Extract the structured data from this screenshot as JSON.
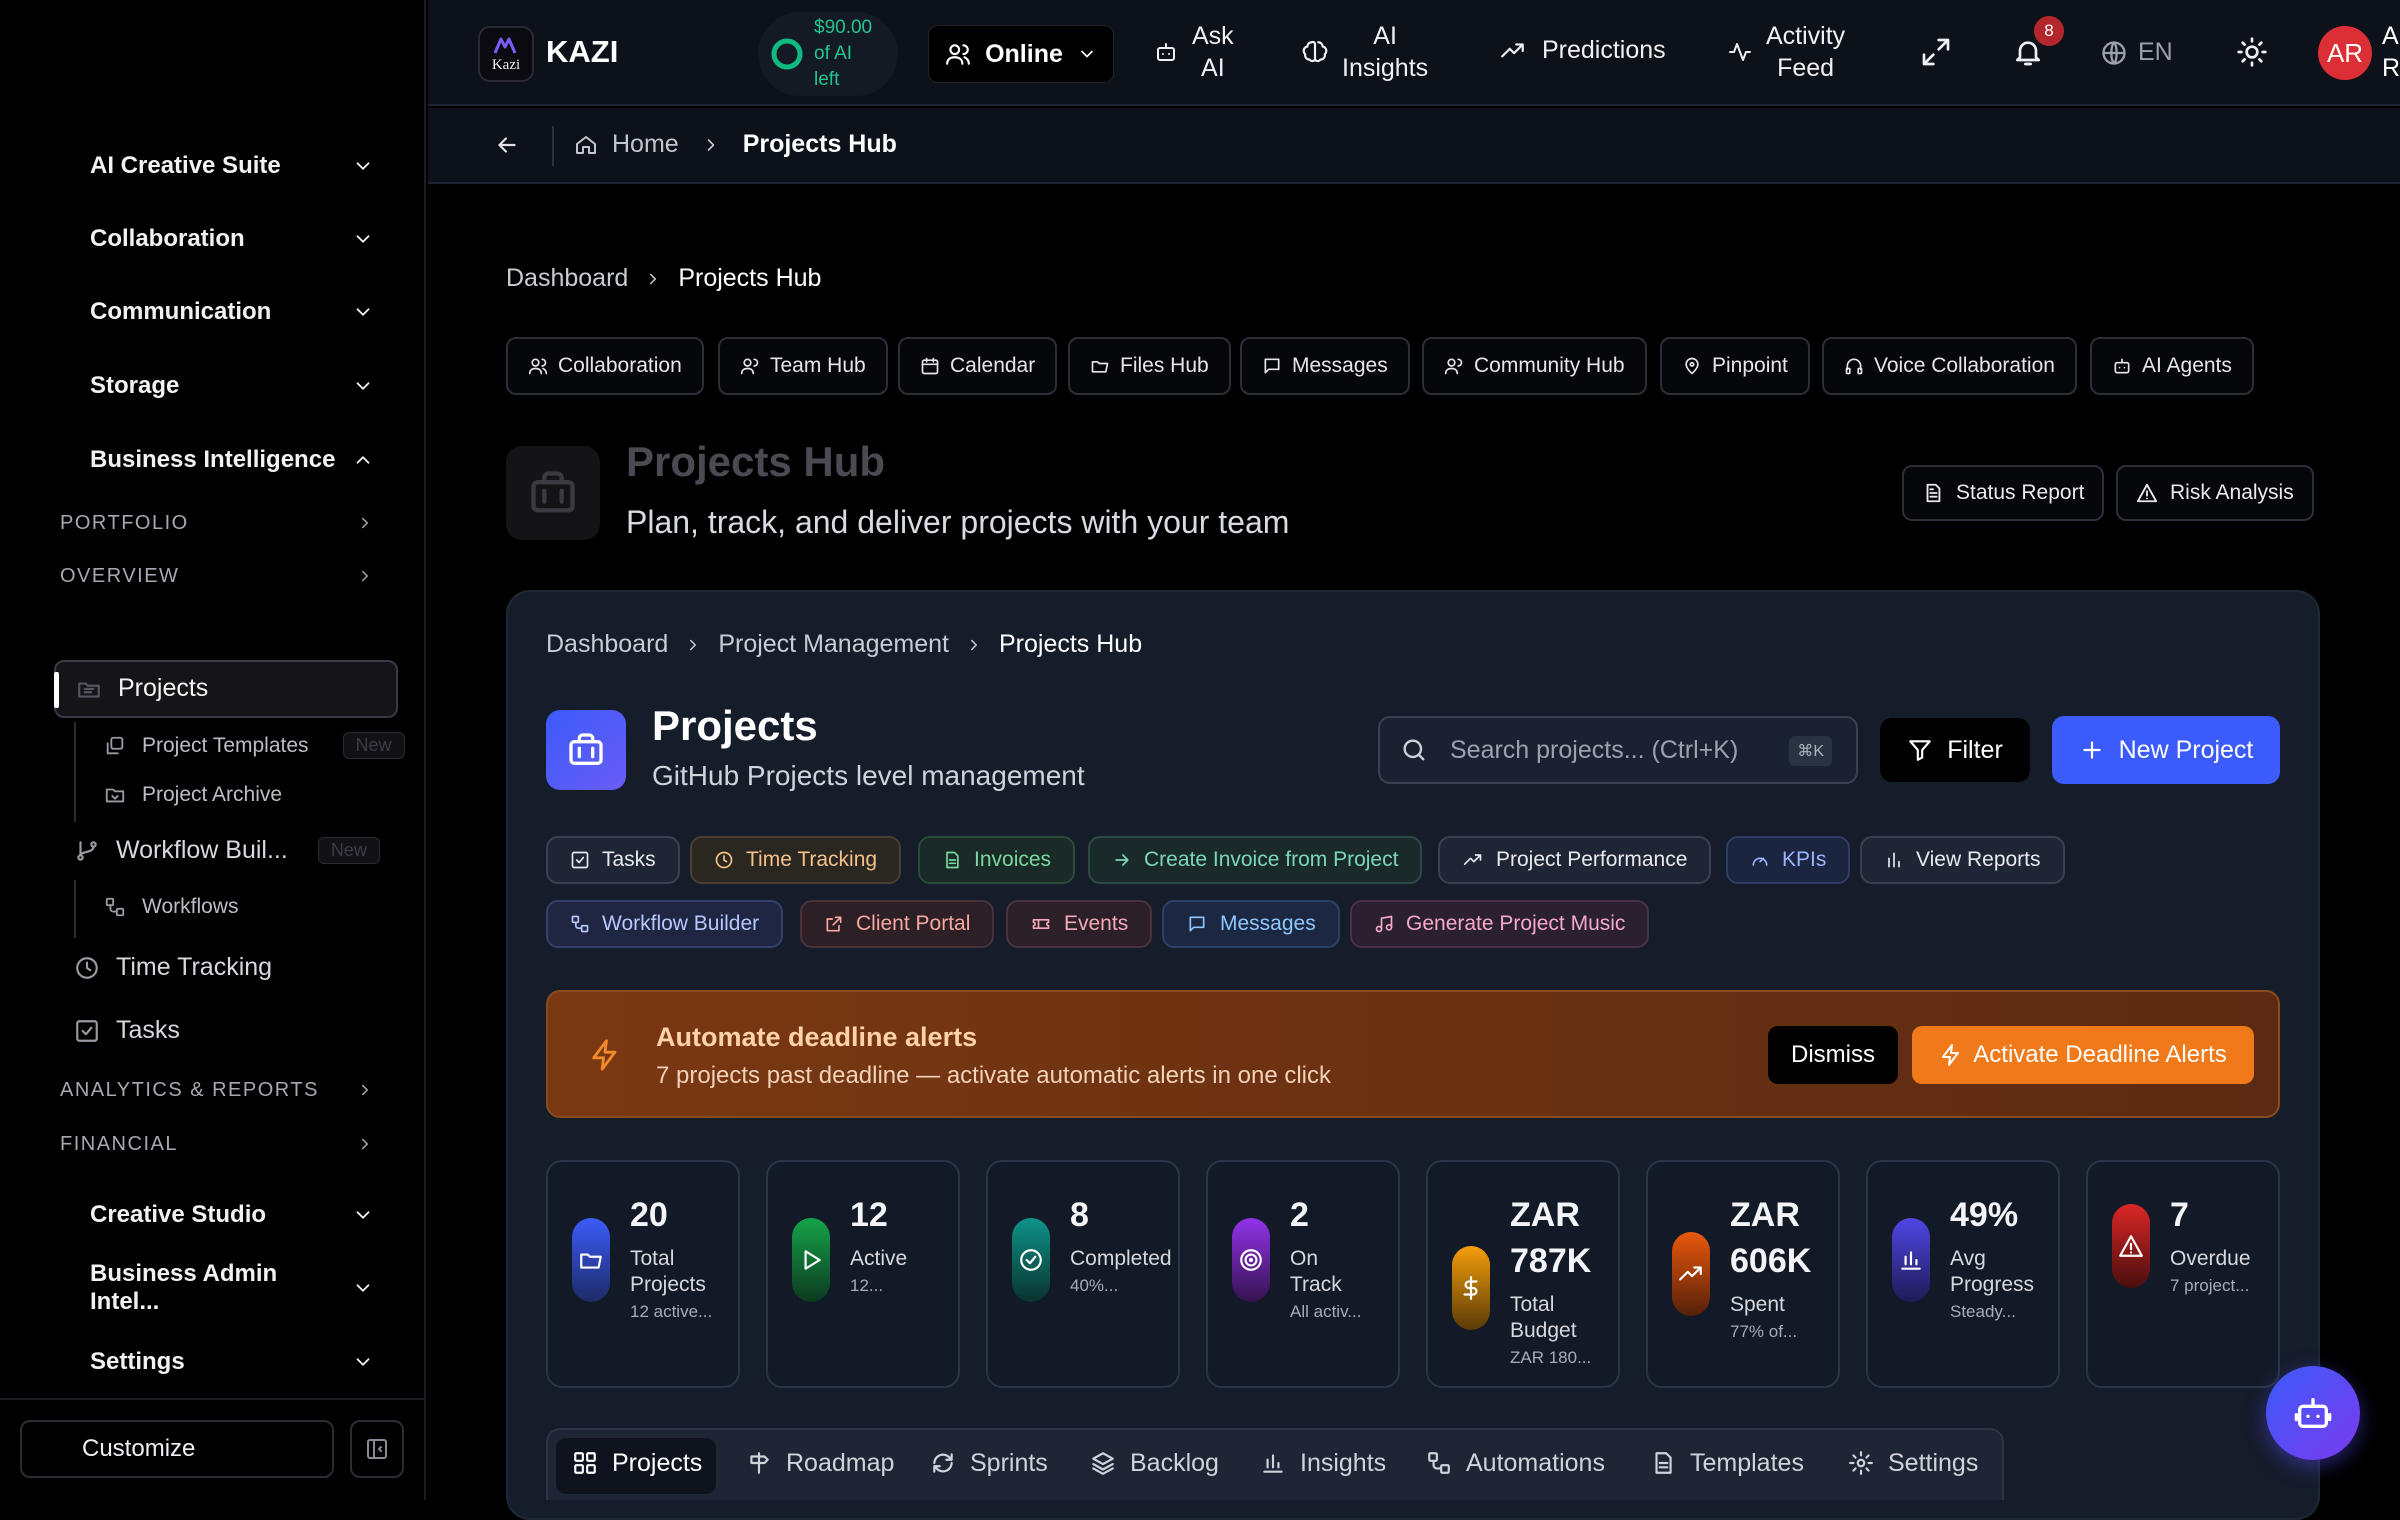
{
  "sidebar": {
    "groups": {
      "ai_creative_suite": "AI Creative Suite",
      "collaboration": "Collaboration",
      "communication": "Communication",
      "storage": "Storage",
      "business_intelligence": "Business Intelligence",
      "creative_studio": "Creative Studio",
      "business_admin": "Business Admin Intel...",
      "settings": "Settings"
    },
    "sections": {
      "portfolio": "PORTFOLIO",
      "overview": "OVERVIEW",
      "analytics": "ANALYTICS & REPORTS",
      "financial": "FINANCIAL"
    },
    "items": {
      "projects": "Projects",
      "project_templates": "Project Templates",
      "project_templates_badge": "New",
      "project_archive": "Project Archive",
      "workflow_builder": "Workflow Buil...",
      "workflow_builder_badge": "New",
      "workflows": "Workflows",
      "time_tracking": "Time Tracking",
      "tasks": "Tasks"
    },
    "customize": "Customize"
  },
  "topbar": {
    "brand": "KAZI",
    "logo_text": "Kazi",
    "ai_credit_line1": "$90.00",
    "ai_credit_line2": "of AI",
    "ai_credit_line3": "left",
    "status": "Online",
    "ask_ai_1": "Ask",
    "ask_ai_2": "AI",
    "ai_insights_1": "AI",
    "ai_insights_2": "Insights",
    "predictions": "Predictions",
    "activity_1": "Activity",
    "activity_2": "Feed",
    "notif_count": "8",
    "language": "EN",
    "avatar": "AR",
    "user_1": "A",
    "user_2": "R"
  },
  "crumbbar": {
    "home": "Home",
    "current": "Projects Hub"
  },
  "page": {
    "crumb_dashboard": "Dashboard",
    "crumb_current": "Projects Hub",
    "chips": [
      "Collaboration",
      "Team Hub",
      "Calendar",
      "Files Hub",
      "Messages",
      "Community Hub",
      "Pinpoint",
      "Voice Collaboration",
      "AI Agents"
    ],
    "title": "Projects Hub",
    "subtitle": "Plan, track, and deliver projects with your team",
    "status_report": "Status Report",
    "risk_analysis": "Risk Analysis"
  },
  "panel": {
    "crumb_1": "Dashboard",
    "crumb_2": "Project Management",
    "crumb_3": "Projects Hub",
    "title": "Projects",
    "subtitle": "GitHub Projects level management",
    "search_placeholder": "Search projects... (Ctrl+K)",
    "search_kbd": "⌘K",
    "filter": "Filter",
    "new_project": "New Project",
    "pills_row1": [
      "Tasks",
      "Time Tracking",
      "Invoices",
      "Create Invoice from Project",
      "Project Performance",
      "KPIs",
      "View Reports"
    ],
    "pills_row2": [
      "Workflow Builder",
      "Client Portal",
      "Events",
      "Messages",
      "Generate Project Music"
    ],
    "alert": {
      "title": "Automate deadline alerts",
      "text": "7 projects past deadline — activate automatic alerts in one click",
      "dismiss": "Dismiss",
      "activate": "Activate Deadline Alerts"
    },
    "stats": [
      {
        "value": "20",
        "label1": "Total",
        "label2": "Projects",
        "sub": "12 active..."
      },
      {
        "value": "12",
        "label1": "Active",
        "label2": "",
        "sub": "12..."
      },
      {
        "value": "8",
        "label1": "Completed",
        "label2": "",
        "sub": "40%..."
      },
      {
        "value": "2",
        "label1": "On",
        "label2": "Track",
        "sub": "All activ..."
      },
      {
        "value": "ZAR",
        "value2": "787K",
        "label1": "Total",
        "label2": "Budget",
        "sub": "ZAR 180..."
      },
      {
        "value": "ZAR",
        "value2": "606K",
        "label1": "Spent",
        "label2": "",
        "sub": "77% of..."
      },
      {
        "value": "49%",
        "label1": "Avg",
        "label2": "Progress",
        "sub": "Steady..."
      },
      {
        "value": "7",
        "label1": "Overdue",
        "label2": "",
        "sub": "7 project..."
      }
    ],
    "tabs": [
      "Projects",
      "Roadmap",
      "Sprints",
      "Backlog",
      "Insights",
      "Automations",
      "Templates",
      "Settings"
    ]
  },
  "colors": {
    "accent": "#3b5bfa",
    "orange": "#f07a1a",
    "alert_bg": "#7a3812"
  }
}
